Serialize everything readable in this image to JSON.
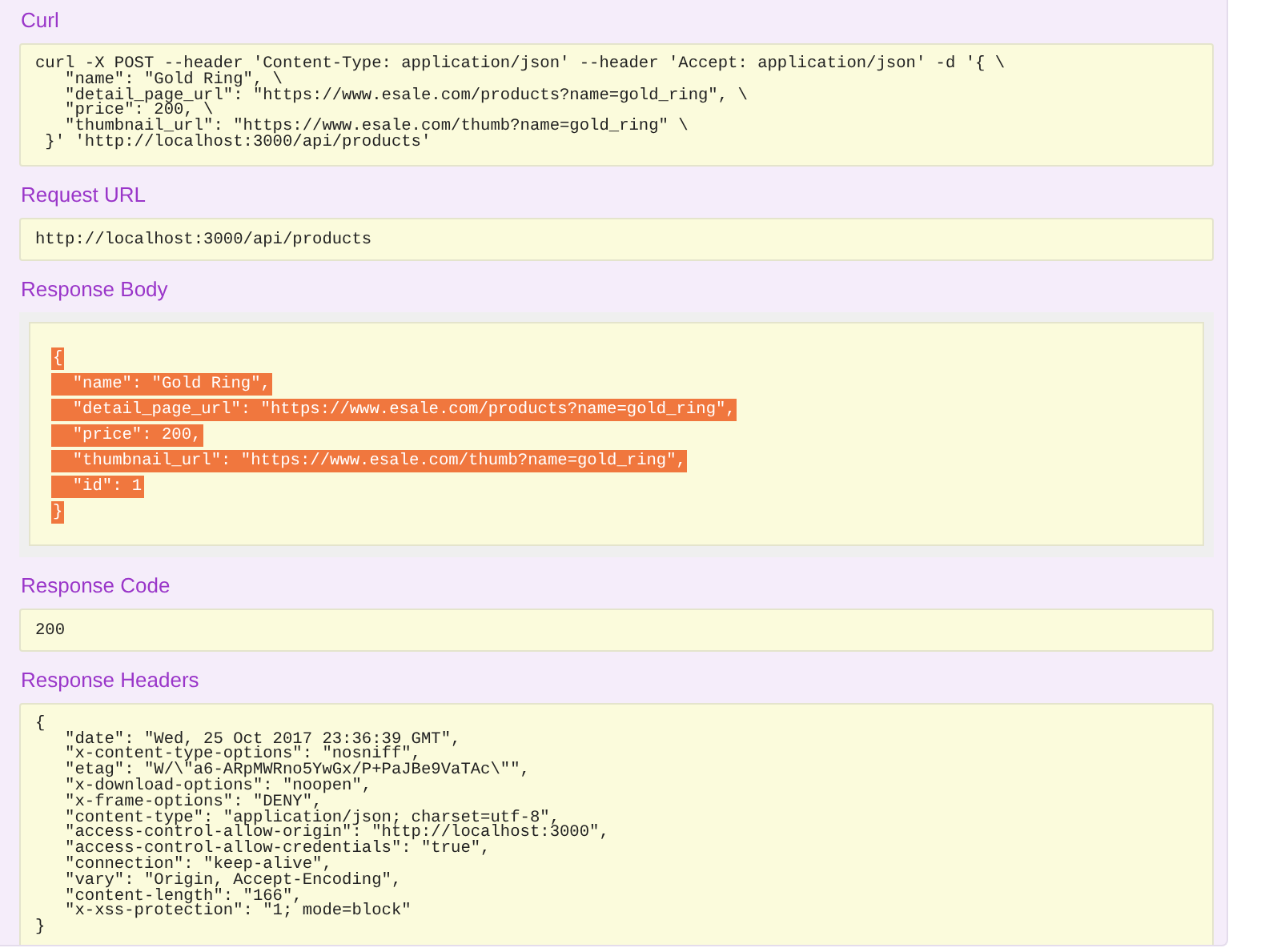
{
  "sections": [
    {
      "title": "Curl",
      "kind": "plain",
      "lines": [
        "curl -X POST --header 'Content-Type: application/json' --header 'Accept: application/json' -d '{ \\",
        "   \"name\": \"Gold Ring\", \\",
        "   \"detail_page_url\": \"https://www.esale.com/products?name=gold_ring\", \\",
        "   \"price\": 200, \\",
        "   \"thumbnail_url\": \"https://www.esale.com/thumb?name=gold_ring\" \\",
        " }' 'http://localhost:3000/api/products'"
      ]
    },
    {
      "title": "Request URL",
      "kind": "single",
      "lines": [
        "http://localhost:3000/api/products"
      ]
    },
    {
      "title": "Response Body",
      "kind": "json",
      "selected": true,
      "lines": [
        "{",
        "  \"name\": \"Gold Ring\",",
        "  \"detail_page_url\": \"https://www.esale.com/products?name=gold_ring\",",
        "  \"price\": 200,",
        "  \"thumbnail_url\": \"https://www.esale.com/thumb?name=gold_ring\",",
        "  \"id\": 1",
        "}"
      ]
    },
    {
      "title": "Response Code",
      "kind": "single",
      "lines": [
        "200"
      ]
    },
    {
      "title": "Response Headers",
      "kind": "plain",
      "lines": [
        "{",
        "   \"date\": \"Wed, 25 Oct 2017 23:36:39 GMT\",",
        "   \"x-content-type-options\": \"nosniff\",",
        "   \"etag\": \"W/\\\"a6-ARpMWRno5YwGx/P+PaJBe9VaTAc\\\"\",",
        "   \"x-download-options\": \"noopen\",",
        "   \"x-frame-options\": \"DENY\",",
        "   \"content-type\": \"application/json; charset=utf-8\",",
        "   \"access-control-allow-origin\": \"http://localhost:3000\",",
        "   \"access-control-allow-credentials\": \"true\",",
        "   \"connection\": \"keep-alive\",",
        "   \"vary\": \"Origin, Accept-Encoding\",",
        "   \"content-length\": \"166\",",
        "   \"x-xss-protection\": \"1; mode=block\"",
        "}"
      ]
    }
  ]
}
